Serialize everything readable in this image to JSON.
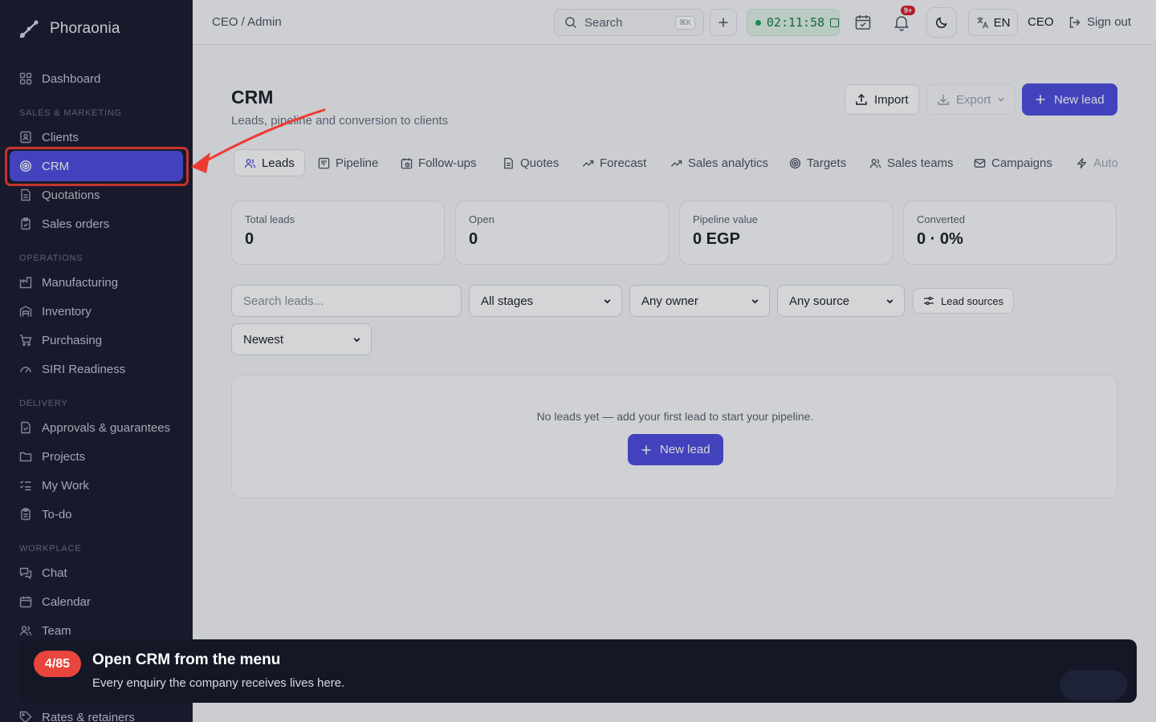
{
  "app": {
    "brand": "Phoraonia"
  },
  "sidebar": {
    "dashboard": "Dashboard",
    "sections": {
      "sales": "SALES & MARKETING",
      "operations": "OPERATIONS",
      "delivery": "DELIVERY",
      "workplace": "WORKPLACE"
    },
    "items": {
      "clients": "Clients",
      "crm": "CRM",
      "quotations": "Quotations",
      "sales_orders": "Sales orders",
      "manufacturing": "Manufacturing",
      "inventory": "Inventory",
      "purchasing": "Purchasing",
      "siri": "SIRI Readiness",
      "approvals": "Approvals & guarantees",
      "projects": "Projects",
      "my_work": "My Work",
      "todo": "To-do",
      "chat": "Chat",
      "calendar": "Calendar",
      "team": "Team",
      "rates": "Rates & retainers"
    }
  },
  "topbar": {
    "breadcrumb": "CEO / Admin",
    "search_label": "Search",
    "search_shortcut": "⌘K",
    "timer": "02:11:58",
    "notifications_badge": "9+",
    "language": "EN",
    "role": "CEO",
    "signout": "Sign out"
  },
  "page": {
    "title": "CRM",
    "subtitle": "Leads, pipeline and conversion to clients",
    "import_label": "Import",
    "export_label": "Export",
    "new_lead_label": "New lead"
  },
  "tabs": [
    "Leads",
    "Pipeline",
    "Follow-ups",
    "Quotes",
    "Forecast",
    "Sales analytics",
    "Targets",
    "Sales teams",
    "Campaigns",
    "Auto"
  ],
  "stats": [
    {
      "label": "Total leads",
      "value": "0"
    },
    {
      "label": "Open",
      "value": "0"
    },
    {
      "label": "Pipeline value",
      "value": "0 EGP"
    },
    {
      "label": "Converted",
      "value": "0 · 0%"
    }
  ],
  "filters": {
    "search_placeholder": "Search leads...",
    "stage": "All stages",
    "owner": "Any owner",
    "source": "Any source",
    "lead_sources": "Lead sources",
    "sort": "Newest"
  },
  "empty_state": {
    "message": "No leads yet — add your first lead to start your pipeline.",
    "button": "New lead"
  },
  "tour": {
    "step": "4/85",
    "title": "Open CRM from the menu",
    "description": "Every enquiry the company receives lives here."
  },
  "colors": {
    "accent": "#4f4ce0",
    "sidebar": "#1a1c2e",
    "highlight": "#ee3b31"
  }
}
